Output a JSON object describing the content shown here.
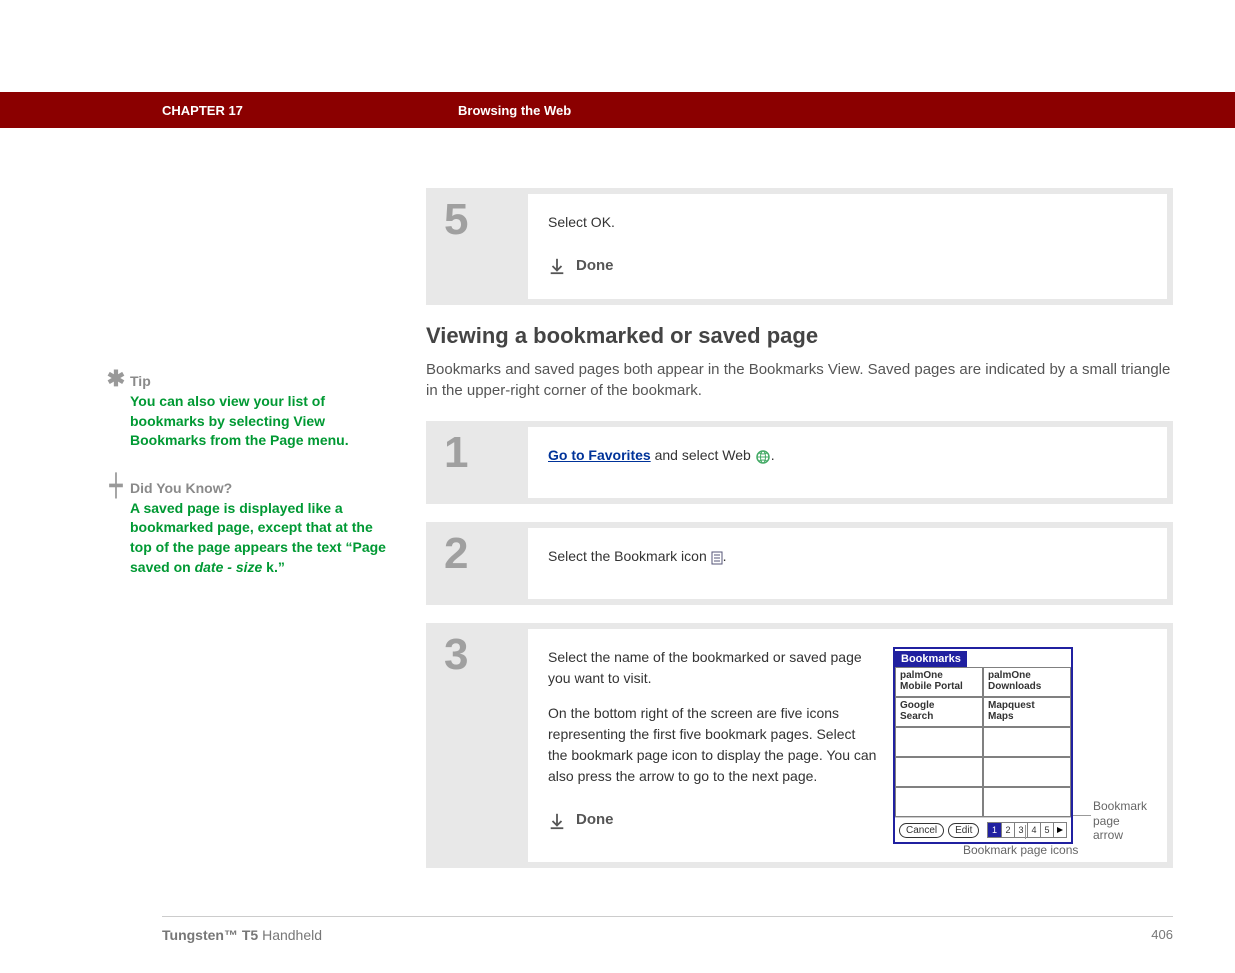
{
  "chapter": {
    "label": "CHAPTER 17",
    "title": "Browsing the Web"
  },
  "sidebar": {
    "tip": {
      "title": "Tip",
      "body": "You can also view your list of bookmarks by selecting View Bookmarks from the Page menu."
    },
    "dyk": {
      "title": "Did You Know?",
      "body_pre": "A saved page is displayed like a bookmarked page, except that at the top of the page appears the text “Page saved on ",
      "body_italic": "date - size",
      "body_post": " k.”"
    }
  },
  "step5": {
    "num": "5",
    "text": "Select OK.",
    "done": "Done"
  },
  "section": {
    "heading": "Viewing a bookmarked or saved page",
    "intro": "Bookmarks and saved pages both appear in the Bookmarks View. Saved pages are indicated by a small triangle in the upper-right corner of the bookmark."
  },
  "step1": {
    "num": "1",
    "link": "Go to Favorites",
    "text_rest": " and select Web ",
    "period": "."
  },
  "step2": {
    "num": "2",
    "text_pre": "Select the Bookmark icon ",
    "text_post": "."
  },
  "step3": {
    "num": "3",
    "p1": "Select the name of the bookmarked or saved page you want to visit.",
    "p2": "On the bottom right of the screen are five icons representing the first five bookmark pages. Select the bookmark page icon to display the page. You can also press the arrow to go to the next page.",
    "done": "Done"
  },
  "palm": {
    "title": "Bookmarks",
    "cells": [
      "palmOne\nMobile Portal",
      "palmOne\nDownloads",
      "Google\nSearch",
      "Mapquest\nMaps"
    ],
    "cancel": "Cancel",
    "edit": "Edit",
    "pages": [
      "1",
      "2",
      "3",
      "4",
      "5"
    ]
  },
  "callouts": {
    "arrow": "Bookmark page arrow",
    "icons": "Bookmark page icons"
  },
  "footer": {
    "product_bold": "Tungsten™ T5",
    "product_rest": " Handheld",
    "page": "406"
  }
}
